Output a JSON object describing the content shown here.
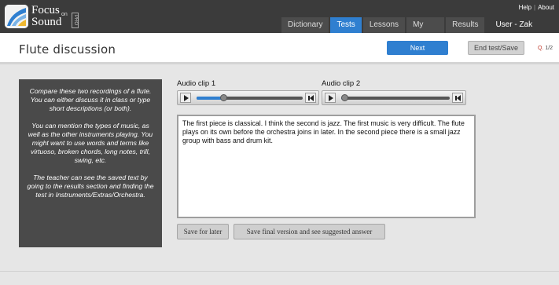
{
  "brand": {
    "line1": "Focus",
    "on": "on",
    "line2": "Sound",
    "edition": "PRO"
  },
  "top_links": {
    "help": "Help",
    "about": "About"
  },
  "tabs": [
    {
      "label": "Dictionary",
      "active": false
    },
    {
      "label": "Tests",
      "active": true
    },
    {
      "label": "Lessons",
      "active": false
    },
    {
      "label": "My Class",
      "active": false
    },
    {
      "label": "Results",
      "active": false
    }
  ],
  "user": "User - Zak Goldberg",
  "page": {
    "title": "Flute discussion",
    "next_label": "Next",
    "end_label": "End test/Save",
    "question_prefix": "Q.",
    "question_value": "1/2"
  },
  "instructions": [
    "Compare these two recordings of a flute. You can either discuss it in class or type short descriptions (or both).",
    "You can mention the types of music, as well as the other instruments playing. You might want to use words and terms like virtuoso, broken chords, long notes, trill, swing, etc.",
    "The teacher can see the saved text by going to the results section and finding the test in Instruments/Extras/Orchestra."
  ],
  "clips": [
    {
      "label": "Audio clip 1",
      "progress": 0.25
    },
    {
      "label": "Audio clip 2",
      "progress": 0.03
    }
  ],
  "answer_text": "The first piece is classical. I think the second is jazz. The first music is very difficult. The flute plays on its own before the orchestra joins in later. In the second piece there is a small jazz group with bass and drum kit.",
  "buttons": {
    "save_later": "Save for later",
    "save_final": "Save final version and see suggested answer"
  },
  "colors": {
    "accent": "#2f7fd0",
    "topbar": "#3b3b3b",
    "panel": "#4a4a4a"
  }
}
